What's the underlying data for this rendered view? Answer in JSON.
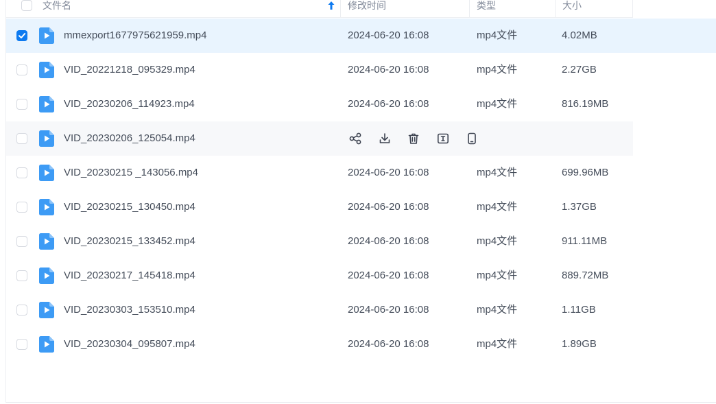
{
  "header": {
    "name": "文件名",
    "modified": "修改时间",
    "type": "类型",
    "size": "大小"
  },
  "rows": [
    {
      "name": "mmexport1677975621959.mp4",
      "time": "2024-06-20 16:08",
      "type": "mp4文件",
      "size": "4.02MB",
      "checked": true
    },
    {
      "name": "VID_20221218_095329.mp4",
      "time": "2024-06-20 16:08",
      "type": "mp4文件",
      "size": "2.27GB",
      "checked": false
    },
    {
      "name": "VID_20230206_114923.mp4",
      "time": "2024-06-20 16:08",
      "type": "mp4文件",
      "size": "816.19MB",
      "checked": false
    },
    {
      "name": "VID_20230206_125054.mp4",
      "time": "",
      "type": "",
      "size": "",
      "checked": false,
      "hovered": true
    },
    {
      "name": "VID_20230215 _143056.mp4",
      "time": "2024-06-20 16:08",
      "type": "mp4文件",
      "size": "699.96MB",
      "checked": false
    },
    {
      "name": "VID_20230215_130450.mp4",
      "time": "2024-06-20 16:08",
      "type": "mp4文件",
      "size": "1.37GB",
      "checked": false
    },
    {
      "name": "VID_20230215_133452.mp4",
      "time": "2024-06-20 16:08",
      "type": "mp4文件",
      "size": "911.11MB",
      "checked": false
    },
    {
      "name": "VID_20230217_145418.mp4",
      "time": "2024-06-20 16:08",
      "type": "mp4文件",
      "size": "889.72MB",
      "checked": false
    },
    {
      "name": "VID_20230303_153510.mp4",
      "time": "2024-06-20 16:08",
      "type": "mp4文件",
      "size": "1.11GB",
      "checked": false
    },
    {
      "name": "VID_20230304_095807.mp4",
      "time": "2024-06-20 16:08",
      "type": "mp4文件",
      "size": "1.89GB",
      "checked": false
    }
  ],
  "hover_actions": [
    "share-icon",
    "download-icon",
    "delete-icon",
    "rename-icon",
    "phone-icon"
  ],
  "colors": {
    "accent": "#0d7af0",
    "selected_row": "#e9f4fe",
    "hover_row": "#f7f8fa",
    "file_icon": "#3d9bf5"
  }
}
